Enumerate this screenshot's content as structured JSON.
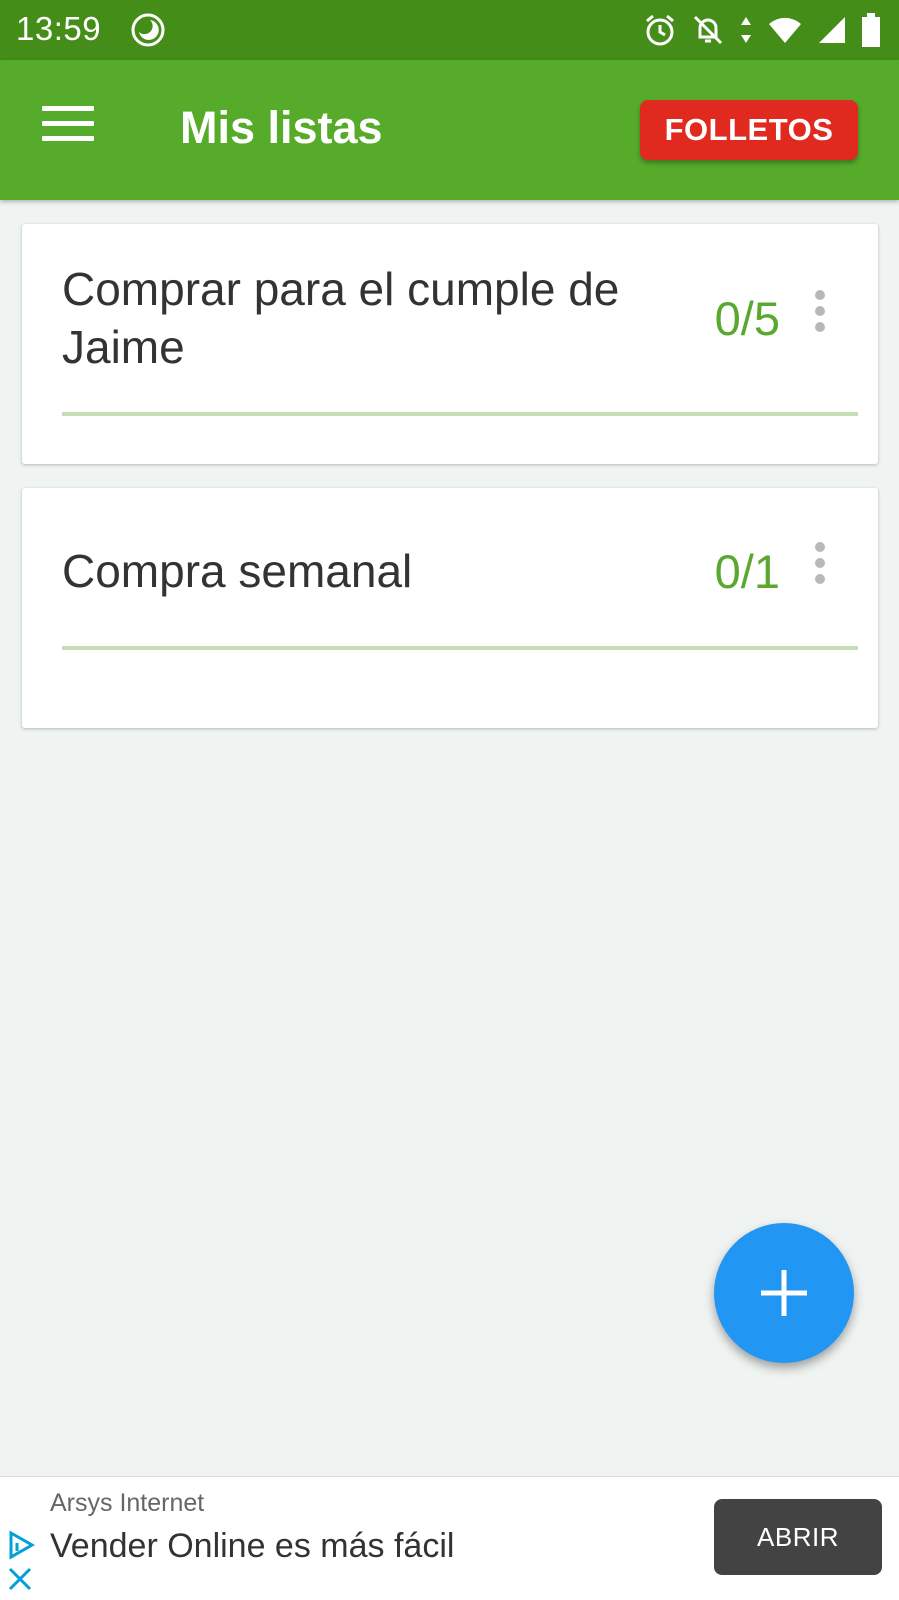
{
  "status_bar": {
    "time": "13:59",
    "icons": [
      "moon-icon",
      "alarm-icon",
      "notifications-off-icon",
      "data-arrows-icon",
      "wifi-icon",
      "signal-icon",
      "battery-icon"
    ],
    "background": "#438d18"
  },
  "app_bar": {
    "title": "Mis listas",
    "action_button": "FOLLETOS",
    "background": "#56ab2a",
    "action_color": "#e12a1f"
  },
  "lists": [
    {
      "title": "Comprar para el cumple de Jaime",
      "count": "0/5",
      "progress": 0
    },
    {
      "title": "Compra semanal",
      "count": "0/1",
      "progress": 0
    }
  ],
  "fab": {
    "icon": "plus-icon",
    "color": "#2196f3"
  },
  "ad": {
    "advertiser": "Arsys Internet",
    "headline": "Vender Online es más fácil",
    "button": "ABRIR",
    "icons": [
      "ad-choices-icon",
      "close-icon"
    ]
  }
}
